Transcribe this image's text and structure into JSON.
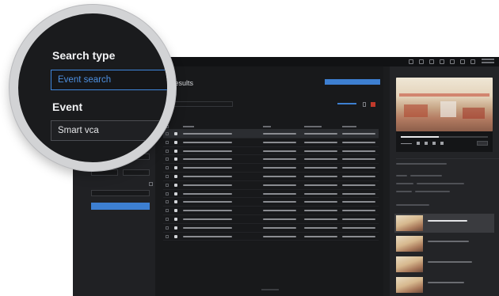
{
  "search_panel": {
    "search_type_label": "Search type",
    "search_type_value": "Event search",
    "event_label": "Event",
    "event_value": "Smart vca"
  },
  "results": {
    "title": "0 results",
    "row_count": 13,
    "selected_row": 1
  },
  "colors": {
    "accent": "#3d7fd1",
    "background": "#1b1c1e",
    "alert": "#c0392b"
  },
  "icons": [
    "camera-icon",
    "settings-icon",
    "user-icon",
    "grid-view-icon",
    "play-icon"
  ]
}
